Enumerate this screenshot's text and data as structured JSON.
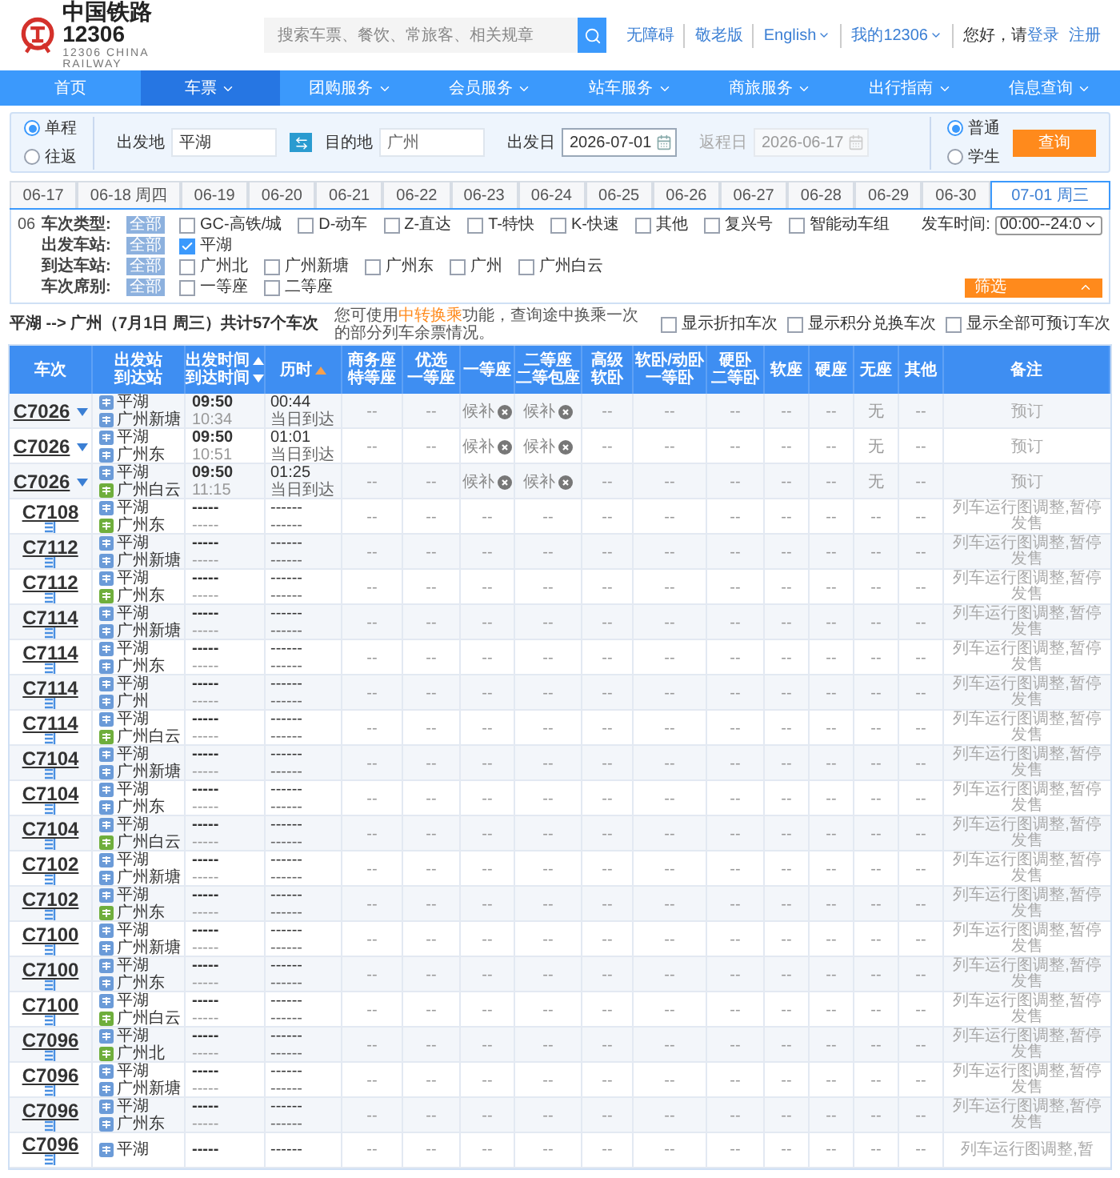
{
  "header": {
    "logo_title": "中国铁路12306",
    "logo_subtitle": "12306 CHINA RAILWAY",
    "search_placeholder": "搜索车票、餐饮、常旅客、相关规章",
    "links": [
      {
        "label": "无障碍",
        "dropdown": false
      },
      {
        "label": "敬老版",
        "dropdown": false
      },
      {
        "label": "English",
        "dropdown": true
      },
      {
        "label": "我的12306",
        "dropdown": true
      }
    ],
    "greeting": "您好，请",
    "login": "登录",
    "register": "注册"
  },
  "nav": [
    {
      "label": "首页",
      "selected": false,
      "dropdown": false
    },
    {
      "label": "车票",
      "selected": true,
      "dropdown": true
    },
    {
      "label": "团购服务",
      "selected": false,
      "dropdown": true
    },
    {
      "label": "会员服务",
      "selected": false,
      "dropdown": true
    },
    {
      "label": "站车服务",
      "selected": false,
      "dropdown": true
    },
    {
      "label": "商旅服务",
      "selected": false,
      "dropdown": true
    },
    {
      "label": "出行指南",
      "selected": false,
      "dropdown": true
    },
    {
      "label": "信息查询",
      "selected": false,
      "dropdown": true
    }
  ],
  "search": {
    "trip_types": [
      {
        "label": "单程",
        "selected": true
      },
      {
        "label": "往返",
        "selected": false
      }
    ],
    "from": {
      "label": "出发地",
      "value": "平湖"
    },
    "to": {
      "label": "目的地",
      "value": "广州"
    },
    "depart_date": {
      "label": "出发日",
      "value": "2026-07-01",
      "disabled": false
    },
    "return_date": {
      "label": "返程日",
      "value": "2026-06-17",
      "disabled": true
    },
    "passenger_types": [
      {
        "label": "普通",
        "selected": true
      },
      {
        "label": "学生",
        "selected": false
      }
    ],
    "submit": "查询"
  },
  "date_tabs": [
    {
      "label": "06-17",
      "selected": false
    },
    {
      "label": "06-18 周四",
      "selected": false
    },
    {
      "label": "06-19",
      "selected": false
    },
    {
      "label": "06-20",
      "selected": false
    },
    {
      "label": "06-21",
      "selected": false
    },
    {
      "label": "06-22",
      "selected": false
    },
    {
      "label": "06-23",
      "selected": false
    },
    {
      "label": "06-24",
      "selected": false
    },
    {
      "label": "06-25",
      "selected": false
    },
    {
      "label": "06-26",
      "selected": false
    },
    {
      "label": "06-27",
      "selected": false
    },
    {
      "label": "06-28",
      "selected": false
    },
    {
      "label": "06-29",
      "selected": false
    },
    {
      "label": "06-30",
      "selected": false
    },
    {
      "label": "07-01 周三",
      "selected": true
    }
  ],
  "filters": {
    "prefix": "06",
    "time_label": "发车时间:",
    "time_value": "00:00--24:0",
    "filter_button": "筛选",
    "rows": [
      {
        "label": "车次类型:",
        "all": "全部",
        "options": [
          {
            "label": "GC-高铁/城",
            "checked": false
          },
          {
            "label": "D-动车",
            "checked": false
          },
          {
            "label": "Z-直达",
            "checked": false
          },
          {
            "label": "T-特快",
            "checked": false
          },
          {
            "label": "K-快速",
            "checked": false
          },
          {
            "label": "其他",
            "checked": false
          },
          {
            "label": "复兴号",
            "checked": false
          },
          {
            "label": "智能动车组",
            "checked": false
          }
        ]
      },
      {
        "label": "出发车站:",
        "all": "全部",
        "options": [
          {
            "label": "平湖",
            "checked": true
          }
        ]
      },
      {
        "label": "到达车站:",
        "all": "全部",
        "options": [
          {
            "label": "广州北",
            "checked": false
          },
          {
            "label": "广州新塘",
            "checked": false
          },
          {
            "label": "广州东",
            "checked": false
          },
          {
            "label": "广州",
            "checked": false
          },
          {
            "label": "广州白云",
            "checked": false
          }
        ]
      },
      {
        "label": "车次席别:",
        "all": "全部",
        "options": [
          {
            "label": "一等座",
            "checked": false
          },
          {
            "label": "二等座",
            "checked": false
          }
        ]
      }
    ]
  },
  "summary": {
    "route": "平湖 --> 广州（7月1日 周三）共计57个车次",
    "hint_before": "您可使用",
    "hint_link": "中转换乘",
    "hint_after": "功能，查询途中换乘一次的部分列车余票情况。",
    "toggles": [
      {
        "label": "显示折扣车次",
        "checked": false
      },
      {
        "label": "显示积分兑换车次",
        "checked": false
      },
      {
        "label": "显示全部可预订车次",
        "checked": false
      }
    ]
  },
  "table": {
    "columns": [
      {
        "lines": [
          {
            "text": "车次"
          }
        ]
      },
      {
        "lines": [
          {
            "text": "出发站"
          },
          {
            "text": "到达站"
          }
        ]
      },
      {
        "lines": [
          {
            "text": "出发时间",
            "kind": "sort_up",
            "sort_active": false
          },
          {
            "text": "到达时间",
            "kind": "sort_down",
            "sort_active": false
          }
        ]
      },
      {
        "lines": [
          {
            "text": "历时",
            "kind": "sort_up",
            "sort_active": true
          }
        ]
      },
      {
        "lines": [
          {
            "text": "商务座"
          },
          {
            "text": "特等座"
          }
        ]
      },
      {
        "lines": [
          {
            "text": "优选"
          },
          {
            "text": "一等座"
          }
        ]
      },
      {
        "lines": [
          {
            "text": "一等座"
          }
        ]
      },
      {
        "lines": [
          {
            "text": "二等座"
          },
          {
            "text": "二等包座"
          }
        ]
      },
      {
        "lines": [
          {
            "text": "高级"
          },
          {
            "text": "软卧"
          }
        ]
      },
      {
        "lines": [
          {
            "text": "软卧/动卧"
          },
          {
            "text": "一等卧"
          }
        ]
      },
      {
        "lines": [
          {
            "text": "硬卧"
          },
          {
            "text": "二等卧"
          }
        ]
      },
      {
        "lines": [
          {
            "text": "软座"
          }
        ]
      },
      {
        "lines": [
          {
            "text": "硬座"
          }
        ]
      },
      {
        "lines": [
          {
            "text": "无座"
          }
        ]
      },
      {
        "lines": [
          {
            "text": "其他"
          }
        ]
      },
      {
        "lines": [
          {
            "text": "备注"
          }
        ]
      }
    ],
    "rows": [
      {
        "train": "C7026",
        "expandable": true,
        "from": {
          "name": "平湖",
          "kind": "pass"
        },
        "to": {
          "name": "广州新塘",
          "kind": "pass"
        },
        "depart": "09:50",
        "arrive": "10:34",
        "duration": "00:44",
        "arrival_day": "当日到达",
        "seats": [
          "--",
          "--",
          {
            "text": "候补",
            "kind": "waitlist"
          },
          {
            "text": "候补",
            "kind": "waitlist"
          },
          "--",
          "--",
          "--",
          "--",
          "--",
          "无",
          "--"
        ],
        "book": {
          "label": "预订",
          "disabled": true
        }
      },
      {
        "train": "C7026",
        "expandable": true,
        "from": {
          "name": "平湖",
          "kind": "pass"
        },
        "to": {
          "name": "广州东",
          "kind": "pass"
        },
        "depart": "09:50",
        "arrive": "10:51",
        "duration": "01:01",
        "arrival_day": "当日到达",
        "seats": [
          "--",
          "--",
          {
            "text": "候补",
            "kind": "waitlist"
          },
          {
            "text": "候补",
            "kind": "waitlist"
          },
          "--",
          "--",
          "--",
          "--",
          "--",
          "无",
          "--"
        ],
        "book": {
          "label": "预订",
          "disabled": true
        }
      },
      {
        "train": "C7026",
        "expandable": true,
        "from": {
          "name": "平湖",
          "kind": "pass"
        },
        "to": {
          "name": "广州白云",
          "kind": "terminal"
        },
        "depart": "09:50",
        "arrive": "11:15",
        "duration": "01:25",
        "arrival_day": "当日到达",
        "seats": [
          "--",
          "--",
          {
            "text": "候补",
            "kind": "waitlist"
          },
          {
            "text": "候补",
            "kind": "waitlist"
          },
          "--",
          "--",
          "--",
          "--",
          "--",
          "无",
          "--"
        ],
        "book": {
          "label": "预订",
          "disabled": true
        }
      },
      {
        "train": "C7108",
        "expandable": false,
        "from": {
          "name": "平湖",
          "kind": "pass"
        },
        "to": {
          "name": "广州东",
          "kind": "terminal"
        },
        "depart": "-----",
        "arrive": "-----",
        "duration": "------",
        "arrival_day": "------",
        "seats": [
          "--",
          "--",
          "--",
          "--",
          "--",
          "--",
          "--",
          "--",
          "--",
          "--",
          "--"
        ],
        "note": "列车运行图调整,暂停发售"
      },
      {
        "train": "C7112",
        "expandable": false,
        "from": {
          "name": "平湖",
          "kind": "pass"
        },
        "to": {
          "name": "广州新塘",
          "kind": "pass"
        },
        "depart": "-----",
        "arrive": "-----",
        "duration": "------",
        "arrival_day": "------",
        "seats": [
          "--",
          "--",
          "--",
          "--",
          "--",
          "--",
          "--",
          "--",
          "--",
          "--",
          "--"
        ],
        "note": "列车运行图调整,暂停发售"
      },
      {
        "train": "C7112",
        "expandable": false,
        "from": {
          "name": "平湖",
          "kind": "pass"
        },
        "to": {
          "name": "广州东",
          "kind": "terminal"
        },
        "depart": "-----",
        "arrive": "-----",
        "duration": "------",
        "arrival_day": "------",
        "seats": [
          "--",
          "--",
          "--",
          "--",
          "--",
          "--",
          "--",
          "--",
          "--",
          "--",
          "--"
        ],
        "note": "列车运行图调整,暂停发售"
      },
      {
        "train": "C7114",
        "expandable": false,
        "from": {
          "name": "平湖",
          "kind": "pass"
        },
        "to": {
          "name": "广州新塘",
          "kind": "pass"
        },
        "depart": "-----",
        "arrive": "-----",
        "duration": "------",
        "arrival_day": "------",
        "seats": [
          "--",
          "--",
          "--",
          "--",
          "--",
          "--",
          "--",
          "--",
          "--",
          "--",
          "--"
        ],
        "note": "列车运行图调整,暂停发售"
      },
      {
        "train": "C7114",
        "expandable": false,
        "from": {
          "name": "平湖",
          "kind": "pass"
        },
        "to": {
          "name": "广州东",
          "kind": "pass"
        },
        "depart": "-----",
        "arrive": "-----",
        "duration": "------",
        "arrival_day": "------",
        "seats": [
          "--",
          "--",
          "--",
          "--",
          "--",
          "--",
          "--",
          "--",
          "--",
          "--",
          "--"
        ],
        "note": "列车运行图调整,暂停发售"
      },
      {
        "train": "C7114",
        "expandable": false,
        "from": {
          "name": "平湖",
          "kind": "pass"
        },
        "to": {
          "name": "广州",
          "kind": "pass"
        },
        "depart": "-----",
        "arrive": "-----",
        "duration": "------",
        "arrival_day": "------",
        "seats": [
          "--",
          "--",
          "--",
          "--",
          "--",
          "--",
          "--",
          "--",
          "--",
          "--",
          "--"
        ],
        "note": "列车运行图调整,暂停发售"
      },
      {
        "train": "C7114",
        "expandable": false,
        "from": {
          "name": "平湖",
          "kind": "pass"
        },
        "to": {
          "name": "广州白云",
          "kind": "terminal"
        },
        "depart": "-----",
        "arrive": "-----",
        "duration": "------",
        "arrival_day": "------",
        "seats": [
          "--",
          "--",
          "--",
          "--",
          "--",
          "--",
          "--",
          "--",
          "--",
          "--",
          "--"
        ],
        "note": "列车运行图调整,暂停发售"
      },
      {
        "train": "C7104",
        "expandable": false,
        "from": {
          "name": "平湖",
          "kind": "pass"
        },
        "to": {
          "name": "广州新塘",
          "kind": "pass"
        },
        "depart": "-----",
        "arrive": "-----",
        "duration": "------",
        "arrival_day": "------",
        "seats": [
          "--",
          "--",
          "--",
          "--",
          "--",
          "--",
          "--",
          "--",
          "--",
          "--",
          "--"
        ],
        "note": "列车运行图调整,暂停发售"
      },
      {
        "train": "C7104",
        "expandable": false,
        "from": {
          "name": "平湖",
          "kind": "pass"
        },
        "to": {
          "name": "广州东",
          "kind": "pass"
        },
        "depart": "-----",
        "arrive": "-----",
        "duration": "------",
        "arrival_day": "------",
        "seats": [
          "--",
          "--",
          "--",
          "--",
          "--",
          "--",
          "--",
          "--",
          "--",
          "--",
          "--"
        ],
        "note": "列车运行图调整,暂停发售"
      },
      {
        "train": "C7104",
        "expandable": false,
        "from": {
          "name": "平湖",
          "kind": "pass"
        },
        "to": {
          "name": "广州白云",
          "kind": "terminal"
        },
        "depart": "-----",
        "arrive": "-----",
        "duration": "------",
        "arrival_day": "------",
        "seats": [
          "--",
          "--",
          "--",
          "--",
          "--",
          "--",
          "--",
          "--",
          "--",
          "--",
          "--"
        ],
        "note": "列车运行图调整,暂停发售"
      },
      {
        "train": "C7102",
        "expandable": false,
        "from": {
          "name": "平湖",
          "kind": "pass"
        },
        "to": {
          "name": "广州新塘",
          "kind": "pass"
        },
        "depart": "-----",
        "arrive": "-----",
        "duration": "------",
        "arrival_day": "------",
        "seats": [
          "--",
          "--",
          "--",
          "--",
          "--",
          "--",
          "--",
          "--",
          "--",
          "--",
          "--"
        ],
        "note": "列车运行图调整,暂停发售"
      },
      {
        "train": "C7102",
        "expandable": false,
        "from": {
          "name": "平湖",
          "kind": "pass"
        },
        "to": {
          "name": "广州东",
          "kind": "terminal"
        },
        "depart": "-----",
        "arrive": "-----",
        "duration": "------",
        "arrival_day": "------",
        "seats": [
          "--",
          "--",
          "--",
          "--",
          "--",
          "--",
          "--",
          "--",
          "--",
          "--",
          "--"
        ],
        "note": "列车运行图调整,暂停发售"
      },
      {
        "train": "C7100",
        "expandable": false,
        "from": {
          "name": "平湖",
          "kind": "pass"
        },
        "to": {
          "name": "广州新塘",
          "kind": "pass"
        },
        "depart": "-----",
        "arrive": "-----",
        "duration": "------",
        "arrival_day": "------",
        "seats": [
          "--",
          "--",
          "--",
          "--",
          "--",
          "--",
          "--",
          "--",
          "--",
          "--",
          "--"
        ],
        "note": "列车运行图调整,暂停发售"
      },
      {
        "train": "C7100",
        "expandable": false,
        "from": {
          "name": "平湖",
          "kind": "pass"
        },
        "to": {
          "name": "广州东",
          "kind": "pass"
        },
        "depart": "-----",
        "arrive": "-----",
        "duration": "------",
        "arrival_day": "------",
        "seats": [
          "--",
          "--",
          "--",
          "--",
          "--",
          "--",
          "--",
          "--",
          "--",
          "--",
          "--"
        ],
        "note": "列车运行图调整,暂停发售"
      },
      {
        "train": "C7100",
        "expandable": false,
        "from": {
          "name": "平湖",
          "kind": "pass"
        },
        "to": {
          "name": "广州白云",
          "kind": "terminal"
        },
        "depart": "-----",
        "arrive": "-----",
        "duration": "------",
        "arrival_day": "------",
        "seats": [
          "--",
          "--",
          "--",
          "--",
          "--",
          "--",
          "--",
          "--",
          "--",
          "--",
          "--"
        ],
        "note": "列车运行图调整,暂停发售"
      },
      {
        "train": "C7096",
        "expandable": false,
        "from": {
          "name": "平湖",
          "kind": "pass"
        },
        "to": {
          "name": "广州北",
          "kind": "terminal"
        },
        "depart": "-----",
        "arrive": "-----",
        "duration": "------",
        "arrival_day": "------",
        "seats": [
          "--",
          "--",
          "--",
          "--",
          "--",
          "--",
          "--",
          "--",
          "--",
          "--",
          "--"
        ],
        "note": "列车运行图调整,暂停发售"
      },
      {
        "train": "C7096",
        "expandable": false,
        "from": {
          "name": "平湖",
          "kind": "pass"
        },
        "to": {
          "name": "广州新塘",
          "kind": "pass"
        },
        "depart": "-----",
        "arrive": "-----",
        "duration": "------",
        "arrival_day": "------",
        "seats": [
          "--",
          "--",
          "--",
          "--",
          "--",
          "--",
          "--",
          "--",
          "--",
          "--",
          "--"
        ],
        "note": "列车运行图调整,暂停发售"
      },
      {
        "train": "C7096",
        "expandable": false,
        "from": {
          "name": "平湖",
          "kind": "pass"
        },
        "to": {
          "name": "广州东",
          "kind": "pass"
        },
        "depart": "-----",
        "arrive": "-----",
        "duration": "------",
        "arrival_day": "------",
        "seats": [
          "--",
          "--",
          "--",
          "--",
          "--",
          "--",
          "--",
          "--",
          "--",
          "--",
          "--"
        ],
        "note": "列车运行图调整,暂停发售"
      },
      {
        "train": "C7096",
        "expandable": false,
        "from": {
          "name": "平湖",
          "kind": "pass"
        },
        "depart": "-----",
        "duration": "------",
        "seats": [
          "--",
          "--",
          "--",
          "--",
          "--",
          "--",
          "--",
          "--",
          "--",
          "--",
          "--"
        ],
        "note": "列车运行图调整,暂"
      }
    ]
  }
}
